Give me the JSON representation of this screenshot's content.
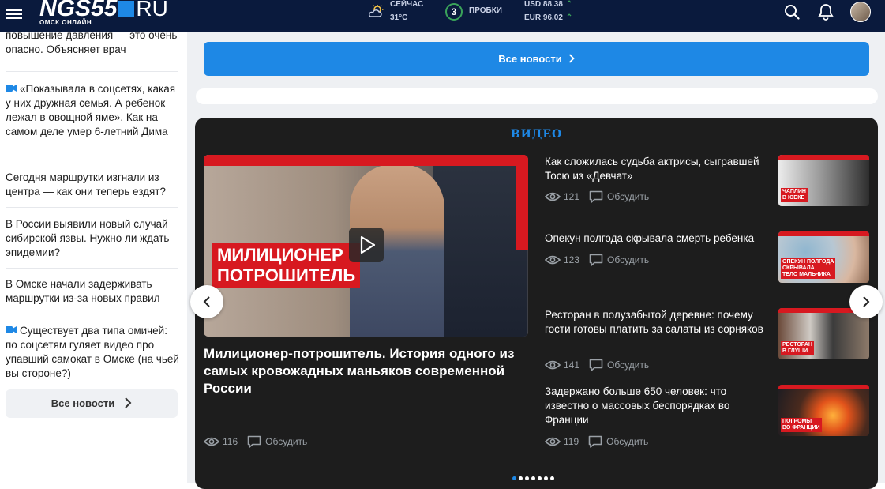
{
  "header": {
    "logo_main": "NGS55",
    "logo_ru": "RU",
    "logo_sub": "ОМСК ОНЛАЙН",
    "weather_label": "СЕЙЧАС",
    "weather_temp": "31°C",
    "traffic_score": "3",
    "traffic_label": "ПРОБКИ",
    "usd": "USD 88.38",
    "eur": "EUR 96.02",
    "rate_arrow": "^",
    "colors": {
      "bg": "#0a1a3d",
      "accent": "#1e88e5",
      "traffic_ok": "#3aa35a"
    },
    "icons": [
      "menu-icon",
      "sun-cloud-icon",
      "search-icon",
      "bell-icon",
      "avatar"
    ]
  },
  "sidebar": {
    "items": [
      {
        "text": "повышение давления — это очень опасно. Объясняет врач",
        "video": false
      },
      {
        "text": "«Показывала в соцсетях, какая у них дружная семья. А ребенок лежал в овощной яме». Как на самом деле умер 6-летний Дима",
        "video": true
      },
      {
        "text": "Сегодня маршрутки изгнали из центра — как они теперь ездят?",
        "video": false
      },
      {
        "text": "В России выявили новый случай сибирской язвы. Нужно ли ждать эпидемии?",
        "video": false
      },
      {
        "text": "В Омске начали задерживать маршрутки из-за новых правил",
        "video": false
      },
      {
        "text": "Существует два типа омичей: по соцсетям гуляет видео про упавший самокат в Омске (на чьей вы стороне?)",
        "video": true
      }
    ],
    "all_news": "Все новости"
  },
  "main": {
    "all_news": "Все новости",
    "video_section_title": "ВИДЕО",
    "featured": {
      "thumb_label": "МИЛИЦИОНЕР\nПОТРОШИТЕЛЬ",
      "title": "Милиционер-потрошитель. История одного из самых кровожадных маньяков современной России",
      "views": "116",
      "discuss": "Обсудить"
    },
    "videos": [
      {
        "title": "Как сложилась судьба актрисы, сыгравшей Тосю из «Девчат»",
        "views": "121",
        "discuss": "Обсудить",
        "thumb_label": "ЧАПЛИН\nВ ЮБКЕ"
      },
      {
        "title": "Опекун полгода скрывала смерть ребенка",
        "views": "123",
        "discuss": "Обсудить",
        "thumb_label": "ОПЕКУН ПОЛГОДА\nСКРЫВАЛА\nТЕЛО МАЛЬЧИКА"
      },
      {
        "title": "Ресторан в полузабытой деревне: почему гости готовы платить за салаты из сорняков",
        "views": "141",
        "discuss": "Обсудить",
        "thumb_label": "РЕСТОРАН\nВ ГЛУШИ"
      },
      {
        "title": "Задержано больше 650 человек: что известно о массовых беспорядках во Франции",
        "views": "119",
        "discuss": "Обсудить",
        "thumb_label": "ПОГРОМЫ\nВО ФРАНЦИИ"
      }
    ],
    "carousel_dots": 7,
    "active_dot": 0
  }
}
